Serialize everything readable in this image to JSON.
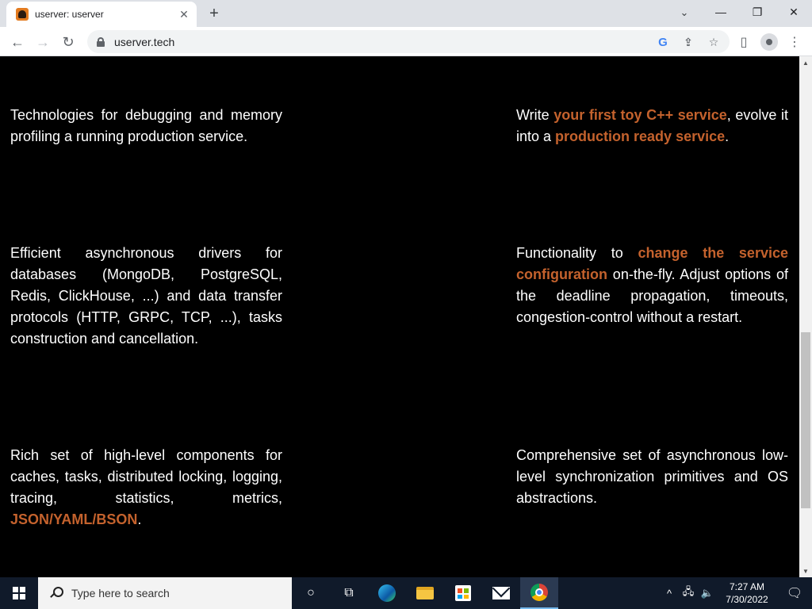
{
  "browser": {
    "tab_title": "userver: userver",
    "tab_close": "✕",
    "new_tab": "+",
    "url": "userver.tech"
  },
  "page": {
    "features": [
      {
        "segments": [
          {
            "text": "Technologies for debugging and memory profiling a running production service."
          }
        ]
      },
      {
        "segments": [
          {
            "text": "Write "
          },
          {
            "text": "your first toy C++ service",
            "link": true
          },
          {
            "text": ", evolve it into a "
          },
          {
            "text": "production ready service",
            "link": true
          },
          {
            "text": "."
          }
        ]
      },
      {
        "segments": [
          {
            "text": "Efficient asynchronous drivers for databases (MongoDB, PostgreSQL, Redis, ClickHouse, ...) and data transfer protocols (HTTP, GRPC, TCP, ...), tasks construction and cancellation."
          }
        ]
      },
      {
        "segments": [
          {
            "text": "Functionality to "
          },
          {
            "text": "change the service configuration",
            "link": true
          },
          {
            "text": " on-the-fly. Adjust options of the deadline propagation, timeouts, congestion-control without a restart."
          }
        ]
      },
      {
        "segments": [
          {
            "text": "Rich set of high-level components for caches, tasks, distributed locking, logging, tracing, statistics, metrics, "
          },
          {
            "text": "JSON/YAML/BSON",
            "link": true
          },
          {
            "text": "."
          }
        ]
      },
      {
        "segments": [
          {
            "text": "Comprehensive set of asynchronous low-level synchronization primitives and OS abstractions."
          }
        ]
      }
    ]
  },
  "taskbar": {
    "search_placeholder": "Type here to search",
    "time": "7:27 AM",
    "date": "7/30/2022"
  },
  "colors": {
    "link": "#c4622d",
    "background": "#000000",
    "text": "#ffffff"
  }
}
